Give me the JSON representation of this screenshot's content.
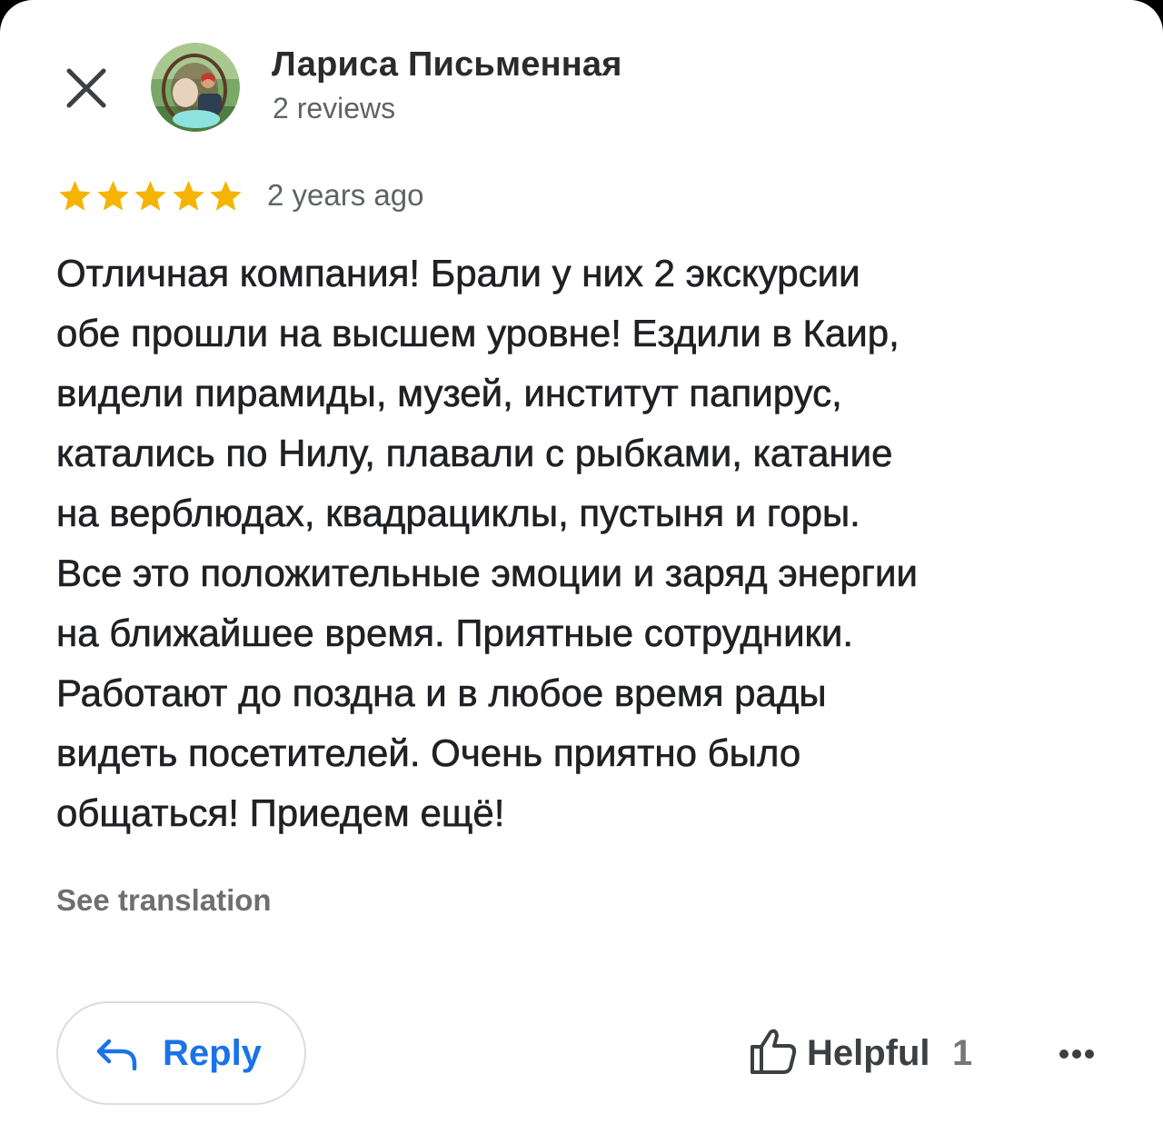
{
  "review": {
    "author": {
      "name": "Лариса Письменная",
      "reviews_count": "2 reviews"
    },
    "rating": 5,
    "rating_max": 5,
    "time_ago": "2 years ago",
    "text_lines": [
      "Отличная компания! Брали у них 2 экскурсии",
      "обе прошли на высшем уровне! Ездили в Каир,",
      "видели пирамиды, музей, институт папирус,",
      "катались по Нилу, плавали с рыбками, катание",
      "на верблюдах, квадрациклы, пустыня и горы.",
      "Все это положительные эмоции и заряд энергии",
      "на ближайшее время. Приятные сотрудники.",
      "Работают до поздна и в любое время рады",
      "видеть посетителей. Очень приятно было",
      "общаться! Приедем ещё!"
    ],
    "see_translation_label": "See translation"
  },
  "actions": {
    "reply_label": "Reply",
    "helpful_label": "Helpful",
    "helpful_count": "1"
  },
  "icons": {
    "close": "close-icon",
    "star": "star-icon",
    "reply": "reply-arrow-icon",
    "helpful": "thumb-up-icon",
    "more": "more-horizontal-icon"
  },
  "colors": {
    "star": "#F4B400",
    "link": "#1A73E8",
    "secondary_text": "#5F6368",
    "primary_text": "#202124"
  }
}
